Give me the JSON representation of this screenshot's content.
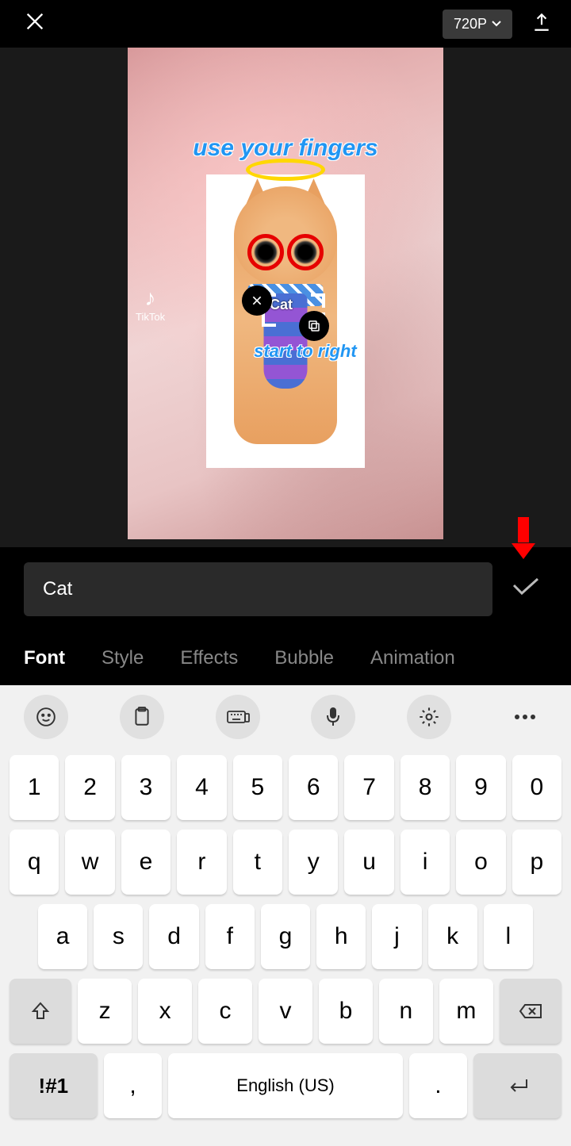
{
  "top_bar": {
    "resolution": "720P"
  },
  "preview": {
    "overlay_text_top": "use your fingers",
    "overlay_text_bottom": "start to right",
    "watermark": "TikTok",
    "text_overlay_preview": "Cat"
  },
  "input": {
    "value": "Cat"
  },
  "tabs": [
    {
      "label": "Font",
      "active": true
    },
    {
      "label": "Style",
      "active": false
    },
    {
      "label": "Effects",
      "active": false
    },
    {
      "label": "Bubble",
      "active": false
    },
    {
      "label": "Animation",
      "active": false
    }
  ],
  "keyboard": {
    "row_numbers": [
      "1",
      "2",
      "3",
      "4",
      "5",
      "6",
      "7",
      "8",
      "9",
      "0"
    ],
    "row_top": [
      "q",
      "w",
      "e",
      "r",
      "t",
      "y",
      "u",
      "i",
      "o",
      "p"
    ],
    "row_mid": [
      "a",
      "s",
      "d",
      "f",
      "g",
      "h",
      "j",
      "k",
      "l"
    ],
    "row_bot": [
      "z",
      "x",
      "c",
      "v",
      "b",
      "n",
      "m"
    ],
    "sym": "!#1",
    "comma": ",",
    "space": "English (US)",
    "dot": "."
  }
}
